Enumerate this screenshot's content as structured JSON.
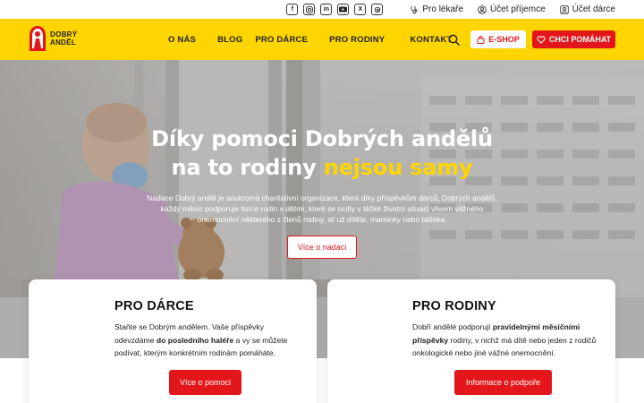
{
  "topbar": {
    "socials": [
      "f",
      "ig",
      "in",
      "yt",
      "X",
      "th"
    ],
    "links": [
      {
        "label": "Pro lékaře",
        "icon": "stethoscope-icon"
      },
      {
        "label": "Účet příjemce",
        "icon": "user-icon"
      },
      {
        "label": "Účet dárce",
        "icon": "user-square-icon"
      }
    ]
  },
  "logo": {
    "line1": "DOBRÝ",
    "line2": "ANDĚL"
  },
  "nav": {
    "items": [
      "O NÁS",
      "BLOG",
      "PRO DÁRCE",
      "PRO RODINY",
      "KONTAKT"
    ],
    "eshop_label": "E-SHOP",
    "help_label": "CHCI POMÁHAT"
  },
  "hero": {
    "title_line1": "Díky pomoci Dobrých andělů",
    "title_line2_start": "na to rodiny ",
    "title_line2_highlight": "nejsou samy",
    "text": "Nadace Dobrý anděl je soukromá charitativní organizace, která díky příspěvkům dárců, Dobrých andělů, každý měsíc podporuje tisíce rodin s dětmi, které se ocitly v těžké životní situaci vlivem vážného onemocnění některého z členů rodiny, ať už dítěte, maminky nebo tatínka.",
    "button_label": "Více o nadaci"
  },
  "cards": {
    "donors": {
      "title": "PRO DÁRCE",
      "text_1": "Staňte se Dobrým andělem. Vaše příspěvky odevzdáme ",
      "text_bold": "do posledního haléře",
      "text_2": " a vy se můžete podívat, kterým konkrétním rodinám pomáháte.",
      "button_label": "Více o pomoci"
    },
    "families": {
      "title": "PRO RODINY",
      "text_1": "Dobří andělé podporují ",
      "text_bold": "pravidelnými měsíčními příspěvky",
      "text_2": " rodiny, v nichž má dítě nebo jeden z rodičů onkologické nebo jiné vážné onemocnění.",
      "button_label": "Informace o podpoře"
    }
  },
  "colors": {
    "brand_yellow": "#ffd500",
    "brand_red": "#e3161b"
  }
}
